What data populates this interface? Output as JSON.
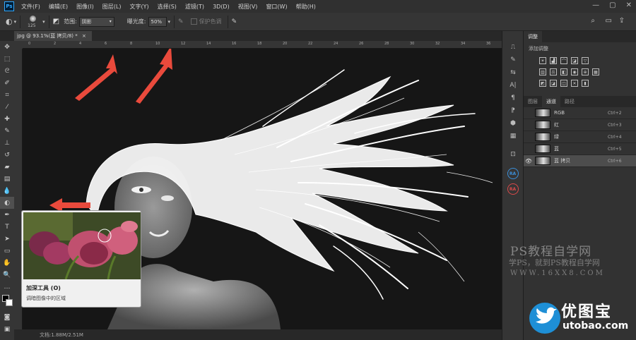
{
  "menubar": {
    "logo": "Ps",
    "items": [
      "文件(F)",
      "编辑(E)",
      "图像(I)",
      "图层(L)",
      "文字(Y)",
      "选择(S)",
      "滤镜(T)",
      "3D(D)",
      "视图(V)",
      "窗口(W)",
      "帮助(H)"
    ]
  },
  "options": {
    "brush_size": "125",
    "range_label": "范围:",
    "range_value": "阴影",
    "exposure_label": "曝光度:",
    "exposure_value": "50%",
    "protect_label": "保护色调"
  },
  "document": {
    "tab_title": "jpg @ 93.1%(蓝 拷贝/8) *",
    "ruler_ticks": [
      "0",
      "2",
      "4",
      "6",
      "8",
      "10",
      "12",
      "14",
      "16",
      "18",
      "20",
      "22",
      "24",
      "26",
      "28",
      "30",
      "32",
      "34",
      "36"
    ],
    "status": "文档:1.88M/2.51M"
  },
  "tooltip": {
    "title": "加深工具 (O)",
    "description": "调暗图像中的区域"
  },
  "panel": {
    "top_tab": "调整",
    "add_adjustment": "添加调整",
    "tabs": [
      "图层",
      "通道",
      "路径"
    ],
    "active_tab": 1,
    "channels": [
      {
        "name": "RGB",
        "shortcut": "Ctrl+2",
        "visible": false,
        "selected": false
      },
      {
        "name": "红",
        "shortcut": "Ctrl+3",
        "visible": false,
        "selected": false
      },
      {
        "name": "绿",
        "shortcut": "Ctrl+4",
        "visible": false,
        "selected": false
      },
      {
        "name": "蓝",
        "shortcut": "Ctrl+5",
        "visible": false,
        "selected": false
      },
      {
        "name": "蓝 拷贝",
        "shortcut": "Ctrl+6",
        "visible": true,
        "selected": true
      }
    ]
  },
  "strip": {
    "badge": "RA"
  },
  "watermark": {
    "line1": "PS教程自学网",
    "line2": "学PS，就到PS教程自学网",
    "line3": "WWW.16XX8.COM",
    "logo_cn": "优图宝",
    "logo_en": "utobao.com"
  },
  "colors": {
    "accent": "#31a8ff",
    "arrow": "#e94a3c",
    "panel": "#323232",
    "selection": "#4d4d4d"
  }
}
